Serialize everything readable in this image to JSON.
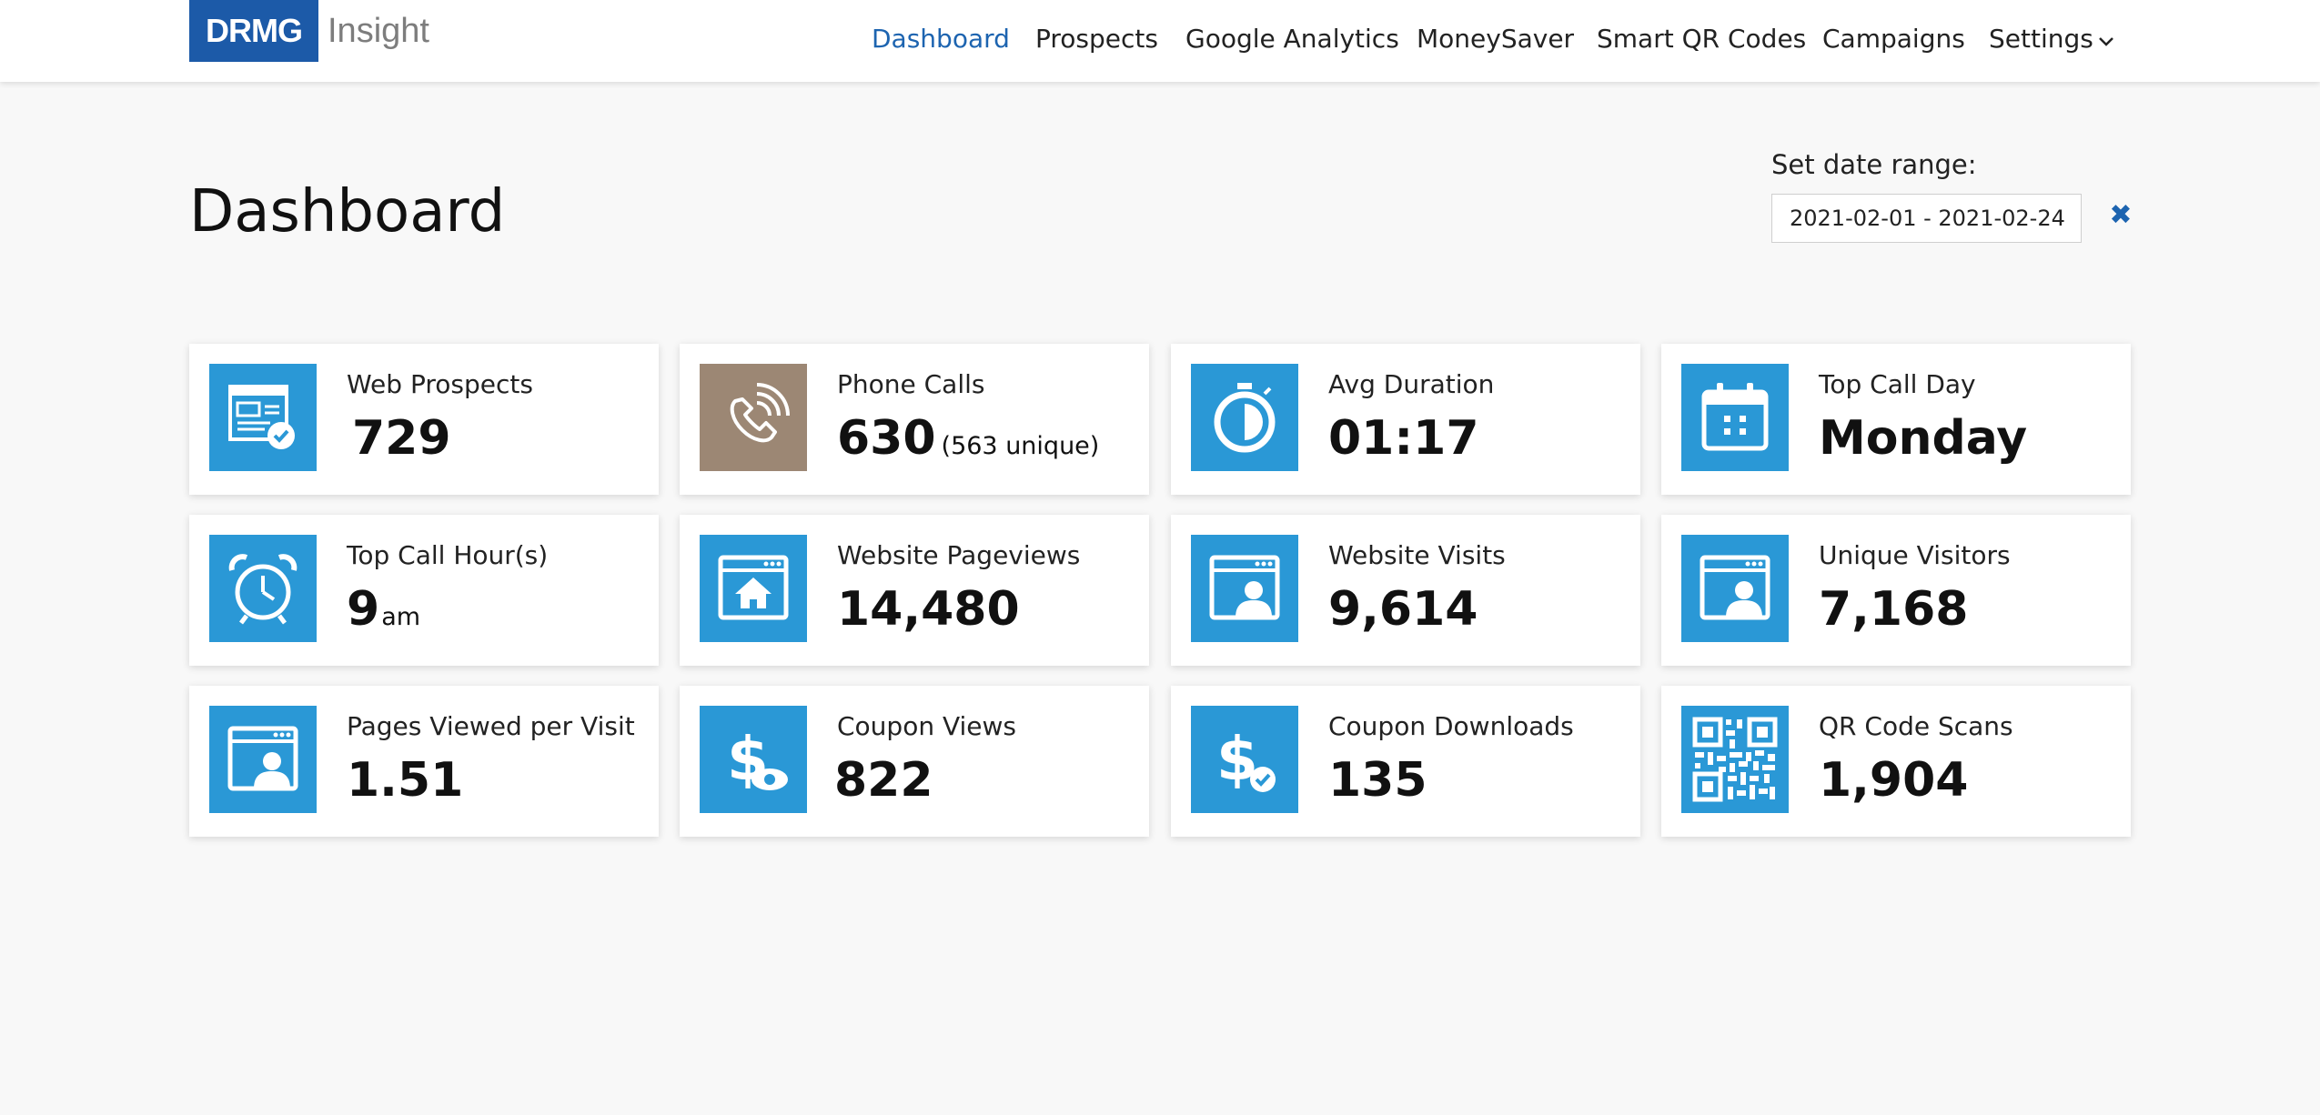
{
  "header": {
    "logo_box": "DRMG",
    "logo_text": "Insight",
    "nav": [
      {
        "label": "Dashboard",
        "active": true
      },
      {
        "label": "Prospects"
      },
      {
        "label": "Google Analytics"
      },
      {
        "label": "MoneySaver"
      },
      {
        "label": "Smart QR Codes"
      },
      {
        "label": "Campaigns"
      },
      {
        "label": "Settings"
      }
    ]
  },
  "page": {
    "title": "Dashboard",
    "date_range_label": "Set date range:",
    "date_range_value": "2021-02-01 - 2021-02-24",
    "clear_icon": "✖"
  },
  "colors": {
    "accent": "#1d64b0",
    "icon_blue": "#2a98d6",
    "icon_brown": "#9c8774",
    "logo_blue": "#1c5aa8"
  },
  "cards": [
    {
      "label": "Web Prospects",
      "value": "729",
      "icon": "form-check-icon"
    },
    {
      "label": "Phone Calls",
      "value": "630",
      "extra": "(563 unique)",
      "icon": "phone-call-icon"
    },
    {
      "label": "Avg Duration",
      "value": "01:17",
      "icon": "stopwatch-icon"
    },
    {
      "label": "Top Call Day",
      "value": "Monday",
      "icon": "calendar-icon"
    },
    {
      "label": "Top Call Hour(s)",
      "value": "9",
      "unit": "am",
      "icon": "alarm-clock-icon"
    },
    {
      "label": "Website Pageviews",
      "value": "14,480",
      "icon": "browser-home-icon"
    },
    {
      "label": "Website Visits",
      "value": "9,614",
      "icon": "browser-user-icon"
    },
    {
      "label": "Unique Visitors",
      "value": "7,168",
      "icon": "browser-user-icon"
    },
    {
      "label": "Pages Viewed per Visit",
      "value": "1.51",
      "icon": "browser-user-icon"
    },
    {
      "label": "Coupon Views",
      "value": "822",
      "icon": "dollar-eye-icon"
    },
    {
      "label": "Coupon Downloads",
      "value": "135",
      "icon": "dollar-check-icon"
    },
    {
      "label": "QR Code Scans",
      "value": "1,904",
      "icon": "qr-code-icon"
    }
  ]
}
